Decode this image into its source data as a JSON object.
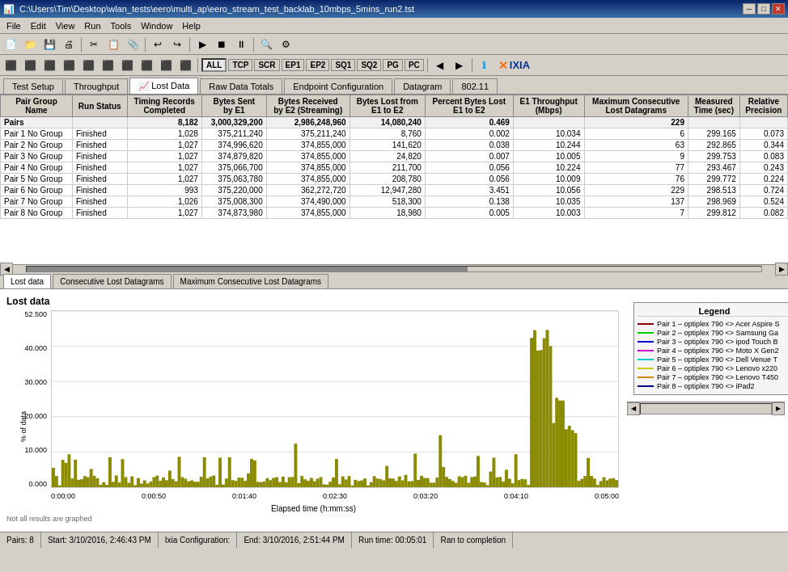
{
  "window": {
    "title": "C:\\Users\\Tim\\Desktop\\wlan_tests\\eero\\multi_ap\\eero_stream_test_backlab_10mbps_5mins_run2.tst"
  },
  "title_controls": {
    "minimize": "─",
    "maximize": "□",
    "close": "✕"
  },
  "menu": {
    "items": [
      "File",
      "Edit",
      "View",
      "Run",
      "Tools",
      "Window",
      "Help"
    ]
  },
  "protocols": {
    "all": "ALL",
    "tcp": "TCP",
    "scr": "SCR",
    "ep1": "EP1",
    "ep2": "EP2",
    "sq1": "SQ1",
    "sq2": "SQ2",
    "pg": "PG",
    "pc": "PC"
  },
  "tabs": {
    "main": [
      "Test Setup",
      "Throughput",
      "Lost Data",
      "Raw Data Totals",
      "Endpoint Configuration",
      "Datagram",
      "802.11"
    ]
  },
  "table": {
    "headers": [
      "Pair Group\nName",
      "Run Status",
      "Timing Records\nCompleted",
      "Bytes Sent\nby E1",
      "Bytes Received\nby E2 (Streaming)",
      "Bytes Lost from\nE1 to E2",
      "Percent Bytes Lost\nE1 to E2",
      "E1 Throughput\n(Mbps)",
      "Maximum Consecutive\nLost Datagrams",
      "Measured\nTime (sec)",
      "Relative\nPrecision"
    ],
    "total_row": {
      "name": "Pairs",
      "status": "",
      "timing": "8,182",
      "bytes_sent": "3,000,329,200",
      "bytes_recv": "2,986,248,960",
      "bytes_lost": "14,080,240",
      "pct_lost": "0.469",
      "throughput": "",
      "max_consec": "229",
      "meas_time": "",
      "rel_prec": ""
    },
    "rows": [
      {
        "name": "Pair 1 No Group",
        "status": "Finished",
        "timing": "1,028",
        "bytes_sent": "375,211,240",
        "bytes_recv": "375,211,240",
        "bytes_lost": "8,760",
        "pct_lost": "0.002",
        "throughput": "10.034",
        "max_consec": "6",
        "meas_time": "299.165",
        "rel_prec": "0.073"
      },
      {
        "name": "Pair 2 No Group",
        "status": "Finished",
        "timing": "1,027",
        "bytes_sent": "374,996,620",
        "bytes_recv": "374,855,000",
        "bytes_lost": "141,620",
        "pct_lost": "0.038",
        "throughput": "10.244",
        "max_consec": "63",
        "meas_time": "292.865",
        "rel_prec": "0.344"
      },
      {
        "name": "Pair 3 No Group",
        "status": "Finished",
        "timing": "1,027",
        "bytes_sent": "374,879,820",
        "bytes_recv": "374,855,000",
        "bytes_lost": "24,820",
        "pct_lost": "0.007",
        "throughput": "10.005",
        "max_consec": "9",
        "meas_time": "299.753",
        "rel_prec": "0.083"
      },
      {
        "name": "Pair 4 No Group",
        "status": "Finished",
        "timing": "1,027",
        "bytes_sent": "375,066,700",
        "bytes_recv": "374,855,000",
        "bytes_lost": "211,700",
        "pct_lost": "0.056",
        "throughput": "10.224",
        "max_consec": "77",
        "meas_time": "293.467",
        "rel_prec": "0.243"
      },
      {
        "name": "Pair 5 No Group",
        "status": "Finished",
        "timing": "1,027",
        "bytes_sent": "375,063,780",
        "bytes_recv": "374,855,000",
        "bytes_lost": "208,780",
        "pct_lost": "0.056",
        "throughput": "10.009",
        "max_consec": "76",
        "meas_time": "299.772",
        "rel_prec": "0.224"
      },
      {
        "name": "Pair 6 No Group",
        "status": "Finished",
        "timing": "993",
        "bytes_sent": "375,220,000",
        "bytes_recv": "362,272,720",
        "bytes_lost": "12,947,280",
        "pct_lost": "3.451",
        "throughput": "10.056",
        "max_consec": "229",
        "meas_time": "298.513",
        "rel_prec": "0.724"
      },
      {
        "name": "Pair 7 No Group",
        "status": "Finished",
        "timing": "1,026",
        "bytes_sent": "375,008,300",
        "bytes_recv": "374,490,000",
        "bytes_lost": "518,300",
        "pct_lost": "0.138",
        "throughput": "10.035",
        "max_consec": "137",
        "meas_time": "298.969",
        "rel_prec": "0.524"
      },
      {
        "name": "Pair 8 No Group",
        "status": "Finished",
        "timing": "1,027",
        "bytes_sent": "374,873,980",
        "bytes_recv": "374,855,000",
        "bytes_lost": "18,980",
        "pct_lost": "0.005",
        "throughput": "10.003",
        "max_consec": "7",
        "meas_time": "299.812",
        "rel_prec": "0.082"
      }
    ]
  },
  "bottom_tabs": [
    "Lost data",
    "Consecutive Lost Datagrams",
    "Maximum Consecutive Lost Datagrams"
  ],
  "chart": {
    "title": "Lost data",
    "y_axis_label": "% of data",
    "x_axis_label": "Elapsed time (h:mm:ss)",
    "y_ticks": [
      "52.500",
      "40.000",
      "30.000",
      "20.000",
      "10.000",
      "0.000"
    ],
    "x_ticks": [
      "0:00:00",
      "0:00:50",
      "0:01:40",
      "0:02:30",
      "0:03:20",
      "0:04:10",
      "0:05:00"
    ],
    "note": "Not all results are graphed"
  },
  "legend": {
    "title": "Legend",
    "items": [
      {
        "color": "#8B0000",
        "label": "Pair 1 – optiplex 790 <> Acer Aspire S"
      },
      {
        "color": "#00CC00",
        "label": "Pair 2 – optiplex 790 <> Samsung Ga"
      },
      {
        "color": "#0000CC",
        "label": "Pair 3 – optiplex 790 <> ipod Touch B"
      },
      {
        "color": "#CC00CC",
        "label": "Pair 4 – optiplex 790 <> Moto X Gen2"
      },
      {
        "color": "#00CCCC",
        "label": "Pair 5 – optiplex 790 <> Dell Venue T"
      },
      {
        "color": "#CCCC00",
        "label": "Pair 6 – optiplex 790 <> Lenovo x220"
      },
      {
        "color": "#CC8800",
        "label": "Pair 7 – optiplex 790 <> Lenovo T450"
      },
      {
        "color": "#000088",
        "label": "Pair 8 – optiplex 790 <> iPad2"
      }
    ]
  },
  "status_bar": {
    "pairs": "Pairs: 8",
    "start": "Start: 3/10/2016, 2:46:43 PM",
    "ixia_config": "Ixia Configuration:",
    "end": "End: 3/10/2016, 2:51:44 PM",
    "runtime": "Run time: 00:05:01",
    "status": "Ran to completion"
  }
}
